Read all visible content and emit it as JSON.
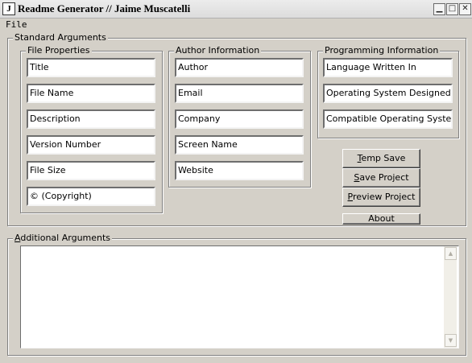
{
  "window": {
    "title": "Readme Generator // Jaime Muscatelli",
    "icon_letter": "J",
    "controls": {
      "minimize": "▁",
      "maximize": "□",
      "close": "✕"
    }
  },
  "menu": {
    "file": "File"
  },
  "standard_arguments": {
    "label": "Standard Arguments",
    "file_properties": {
      "label": "File Properties",
      "fields": [
        "Title",
        "File Name",
        "Description",
        "Version Number",
        "File Size",
        "© (Copyright)"
      ]
    },
    "author_information": {
      "label": "Author Information",
      "fields": [
        "Author",
        "Email",
        "Company",
        "Screen Name",
        "Website"
      ]
    },
    "programming_information": {
      "label": "Programming Information",
      "fields": [
        "Language Written In",
        "Operating System Designed In",
        "Compatible Operating Systems"
      ]
    },
    "buttons": {
      "temp_save": {
        "accel": "T",
        "rest": "emp Save"
      },
      "save_project": {
        "accel": "S",
        "rest": "ave Project"
      },
      "preview_project": {
        "accel": "P",
        "rest": "review Project"
      },
      "about": "About"
    }
  },
  "additional_arguments": {
    "label_accel": "A",
    "label_rest": "dditional Arguments",
    "value": ""
  }
}
